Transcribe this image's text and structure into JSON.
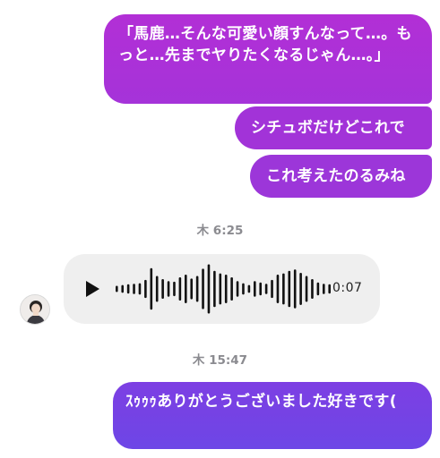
{
  "messages": [
    {
      "text": "「馬鹿…そんな可愛い顔すんなって…。もっと…先までヤりたくなるじゃん…。」"
    },
    {
      "text": "シチュボだけどこれで"
    },
    {
      "text": "これ考えたのるみね"
    },
    {
      "text": "ｽｩｩｩありがとうございました好きです("
    }
  ],
  "timestamps": {
    "first": "木 6:25",
    "second": "木 15:47"
  },
  "voice_message": {
    "duration": "0:07",
    "play_icon": "play-icon",
    "waveform_levels": [
      0.12,
      0.15,
      0.18,
      0.2,
      0.22,
      0.35,
      0.8,
      0.5,
      0.38,
      0.3,
      0.28,
      0.45,
      0.55,
      0.4,
      0.5,
      0.78,
      0.95,
      0.7,
      0.6,
      0.55,
      0.45,
      0.3,
      0.22,
      0.15,
      0.3,
      0.25,
      0.2,
      0.35,
      0.55,
      0.6,
      0.7,
      0.75,
      0.62,
      0.5,
      0.38,
      0.25,
      0.2,
      0.18
    ]
  },
  "colors": {
    "bubble_purple": "#a533d9",
    "bubble_violet": "#6d46e6",
    "voice_bg": "#efefef",
    "timestamp": "#8b8b90"
  }
}
